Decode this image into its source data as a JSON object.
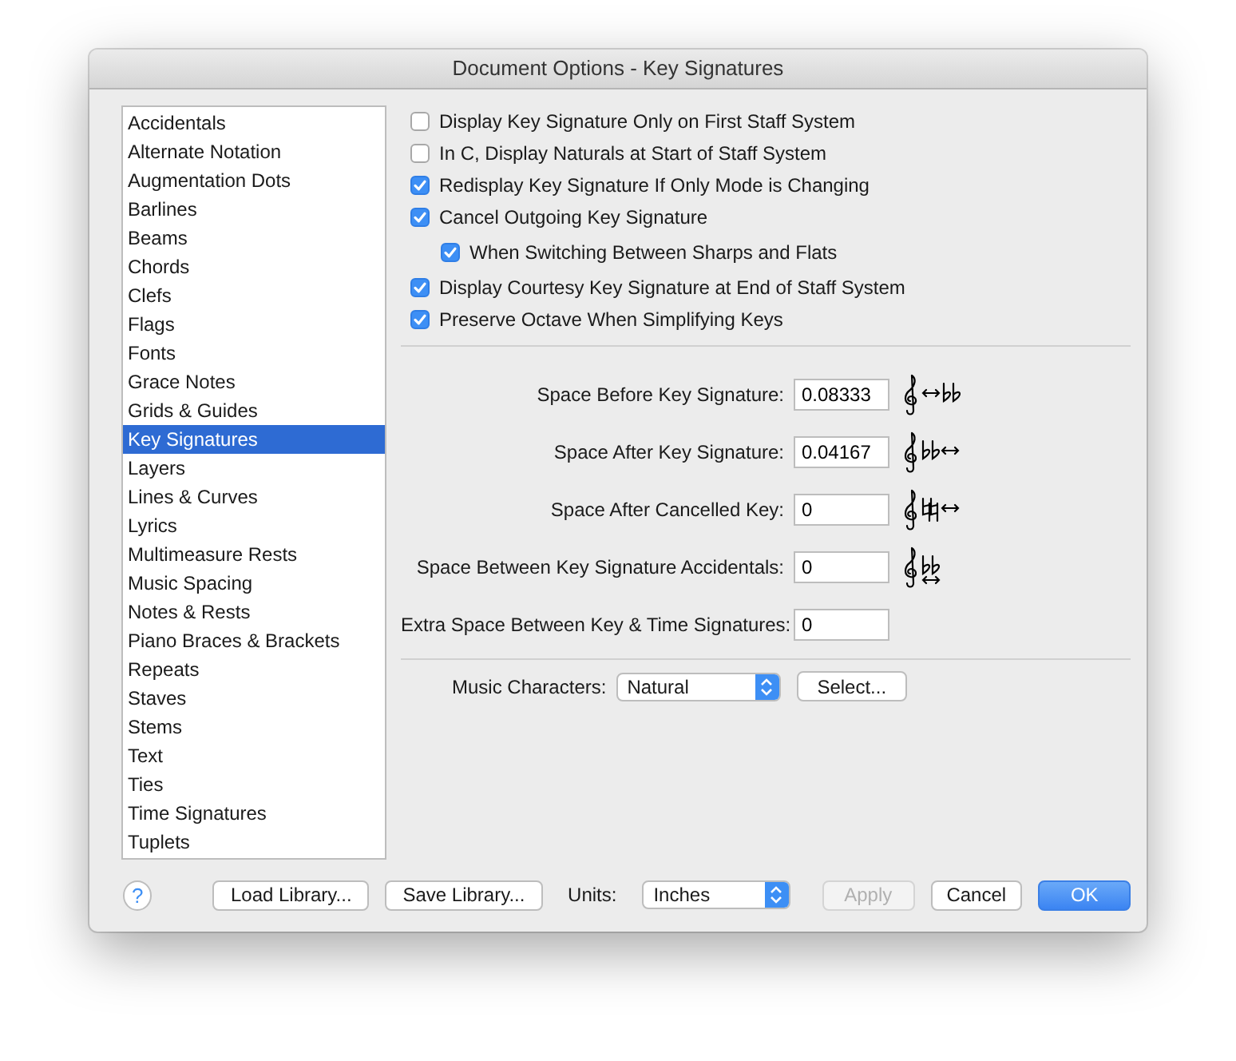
{
  "window": {
    "title": "Document Options - Key Signatures"
  },
  "sidebar": {
    "items": [
      {
        "label": "Accidentals",
        "selected": false
      },
      {
        "label": "Alternate Notation",
        "selected": false
      },
      {
        "label": "Augmentation Dots",
        "selected": false
      },
      {
        "label": "Barlines",
        "selected": false
      },
      {
        "label": "Beams",
        "selected": false
      },
      {
        "label": "Chords",
        "selected": false
      },
      {
        "label": "Clefs",
        "selected": false
      },
      {
        "label": "Flags",
        "selected": false
      },
      {
        "label": "Fonts",
        "selected": false
      },
      {
        "label": "Grace Notes",
        "selected": false
      },
      {
        "label": "Grids & Guides",
        "selected": false
      },
      {
        "label": "Key Signatures",
        "selected": true
      },
      {
        "label": "Layers",
        "selected": false
      },
      {
        "label": "Lines & Curves",
        "selected": false
      },
      {
        "label": "Lyrics",
        "selected": false
      },
      {
        "label": "Multimeasure Rests",
        "selected": false
      },
      {
        "label": "Music Spacing",
        "selected": false
      },
      {
        "label": "Notes & Rests",
        "selected": false
      },
      {
        "label": "Piano Braces & Brackets",
        "selected": false
      },
      {
        "label": "Repeats",
        "selected": false
      },
      {
        "label": "Staves",
        "selected": false
      },
      {
        "label": "Stems",
        "selected": false
      },
      {
        "label": "Text",
        "selected": false
      },
      {
        "label": "Ties",
        "selected": false
      },
      {
        "label": "Time Signatures",
        "selected": false
      },
      {
        "label": "Tuplets",
        "selected": false
      }
    ]
  },
  "options": [
    {
      "label": "Display Key Signature Only on First Staff System",
      "checked": false
    },
    {
      "label": "In C, Display Naturals at Start of Staff System",
      "checked": false
    },
    {
      "label": "Redisplay Key Signature If Only Mode is Changing",
      "checked": true
    },
    {
      "label": "Cancel Outgoing Key Signature",
      "checked": true,
      "children": [
        {
          "label": "When Switching Between Sharps and Flats",
          "checked": true
        }
      ]
    },
    {
      "label": "Display Courtesy Key Signature at End of Staff System",
      "checked": true
    },
    {
      "label": "Preserve Octave When Simplifying Keys",
      "checked": true
    }
  ],
  "spacing_fields": [
    {
      "label": "Space Before Key Signature:",
      "value": "0.08333",
      "kind": "before"
    },
    {
      "label": "Space After Key Signature:",
      "value": "0.04167",
      "kind": "after"
    },
    {
      "label": "Space After Cancelled Key:",
      "value": "0",
      "kind": "cancel"
    },
    {
      "label": "Space Between Key Signature Accidentals:",
      "value": "0",
      "kind": "between"
    },
    {
      "label": "Extra Space Between Key & Time Signatures:",
      "value": "0",
      "kind": "plain"
    }
  ],
  "music_characters": {
    "label": "Music Characters:",
    "value": "Natural",
    "button": "Select..."
  },
  "footer": {
    "help": "?",
    "library_buttons": [
      "Load Library...",
      "Save Library..."
    ],
    "units": {
      "label": "Units:",
      "value": "Inches"
    },
    "buttons": [
      {
        "label": "Apply",
        "disabled": true,
        "default": false
      },
      {
        "label": "Cancel",
        "disabled": false,
        "default": false
      },
      {
        "label": "OK",
        "disabled": false,
        "default": true
      }
    ]
  }
}
